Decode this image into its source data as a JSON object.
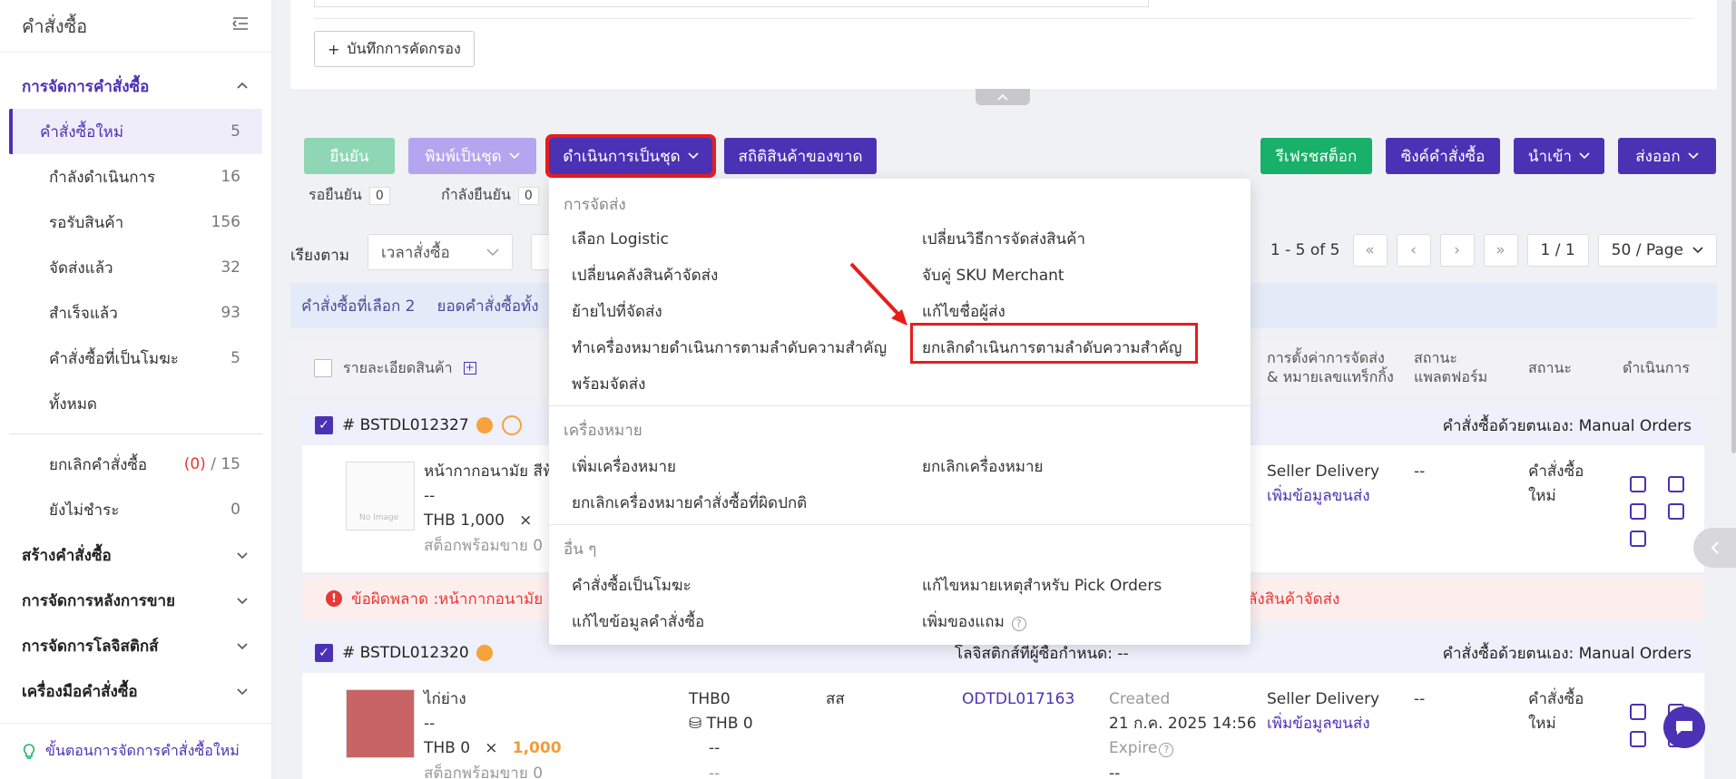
{
  "sidebar": {
    "title": "คำสั่งซื้อ",
    "group_manage": "การจัดการคำสั่งซื้อ",
    "items": [
      {
        "label": "คำสั่งซื้อใหม่",
        "count": "5"
      },
      {
        "label": "กำลังดำเนินการ",
        "count": "16"
      },
      {
        "label": "รอรับสินค้า",
        "count": "156"
      },
      {
        "label": "จัดส่งแล้ว",
        "count": "32"
      },
      {
        "label": "สำเร็จแล้ว",
        "count": "93"
      },
      {
        "label": "คำสั่งซื้อที่เป็นโมฆะ",
        "count": "5"
      },
      {
        "label": "ทั้งหมด",
        "count": ""
      }
    ],
    "cancel_label": "ยกเลิกคำสั่งซื้อ",
    "cancel_count_red": "(0)",
    "cancel_count_total": "/ 15",
    "unpaid_label": "ยังไม่ชำระ",
    "unpaid_count": "0",
    "group_create": "สร้างคำสั่งซื้อ",
    "group_after": "การจัดการหลังการขาย",
    "group_logistics": "การจัดการโลจิสติกส์",
    "group_tools": "เครื่องมือคำสั่งซื้อ",
    "footer": "ขั้นตอนการจัดการคำสั่งซื้อใหม่"
  },
  "filter": {
    "save_label": "บันทึกการคัดกรอง"
  },
  "toolbar": {
    "confirm": "ยืนยัน",
    "print_batch": "พิมพ์เป็นชุด",
    "batch_ops": "ดำเนินการเป็นชุด",
    "stats_oos": "สถิติสินค้าของขาด",
    "refresh_stock": "รีเฟรชสต็อก",
    "sync_orders": "ซิงค์คำสั่งซื้อ",
    "import": "นำเข้า",
    "export": "ส่งออก"
  },
  "status": {
    "pending_label": "รอยืนยัน",
    "pending_count": "0",
    "confirming_label": "กำลังยืนยัน",
    "confirming_count": "0"
  },
  "sort": {
    "label": "เรียงตาม",
    "value": "เวลาสั่งซื้อ"
  },
  "pager": {
    "range": "1 - 5 of 5",
    "page": "1 / 1",
    "per_page": "50 / Page"
  },
  "selection": {
    "selected": "คำสั่งซื้อที่เลือก 2",
    "total": "ยอดคำสั่งซื้อทั้ง"
  },
  "table_head": {
    "product": "รายละเอียดสินค้า",
    "shipping_setup_1": "การตั้งค่าการจัดส่ง",
    "shipping_setup_2": "& หมายเลขแทร็กกิ้ง",
    "platform_status_1": "สถานะ",
    "platform_status_2": "แพลตฟอร์ม",
    "status": "สถานะ",
    "action": "ดำเนินการ"
  },
  "orders": [
    {
      "id": "# BSTDL012327",
      "right": "คำสั่งซื้อด้วยตนเอง: Manual Orders",
      "product": "หน้ากากอนามัย สีฟ้",
      "dash": "--",
      "price": "THB 1,000",
      "times": "×",
      "stock": "สต็อกพร้อมขาย 0",
      "shipping": "Seller Delivery",
      "add_info": "เพิ่มข้อมูลขนส่ง",
      "platform": "--",
      "status_1": "คำสั่งซื้อ",
      "status_2": "ใหม่",
      "no_image": "No Image"
    },
    {
      "id": "# BSTDL012320",
      "middle": "โลจิสติกส์ที่ผู้ซื้อกำหนด: --",
      "right": "คำสั่งซื้อด้วยตนเอง: Manual Orders",
      "product": "ไก่ย่าง",
      "dash": "--",
      "price": "THB 0",
      "times": "×",
      "qty": "1,000",
      "stock": "สต็อกพร้อมขาย 0",
      "amount": "THB0",
      "amount2": "THB 0",
      "amount_dash": "--",
      "amount_dash2": "--",
      "payment": "สส",
      "ref": "ODTDL017163",
      "created_label": "Created",
      "created": "21 ก.ค. 2025 14:56",
      "expire": "Expire",
      "expire_dash": "--",
      "shipping": "Seller Delivery",
      "add_info": "เพิ่มข้อมูลขนส่ง",
      "platform": "--",
      "status_1": "คำสั่งซื้อ",
      "status_2": "ใหม่"
    }
  ],
  "error": {
    "text": "ข้อผิดพลาด :หน้ากากอนามัย สี",
    "tail": "ลังสินค้าจัดส่ง"
  },
  "dropdown": {
    "sec_shipping": "การจัดส่ง",
    "select_logistic": "เลือก Logistic",
    "change_ship_method": "เปลี่ยนวิธีการจัดส่งสินค้า",
    "change_warehouse": "เปลี่ยนคลังสินค้าจัดส่ง",
    "match_sku": "จับคู่ SKU Merchant",
    "move_to_ship": "ย้ายไปที่จัดส่ง",
    "edit_sender": "แก้ไขชื่อผู้ส่ง",
    "mark_priority": "ทำเครื่องหมายดำเนินการตามลำดับความสำคัญ",
    "cancel_priority": "ยกเลิกดำเนินการตามลำดับความสำคัญ",
    "ready_ship": "พร้อมจัดส่ง",
    "sec_mark": "เครื่องหมาย",
    "add_mark": "เพิ่มเครื่องหมาย",
    "cancel_mark": "ยกเลิกเครื่องหมาย",
    "cancel_abnormal": "ยกเลิกเครื่องหมายคำสั่งซื้อที่ผิดปกติ",
    "sec_other": "อื่น ๆ",
    "void_order": "คำสั่งซื้อเป็นโมฆะ",
    "edit_pick_note": "แก้ไขหมายเหตุสำหรับ Pick Orders",
    "edit_order_info": "แก้ไขข้อมูลคำสั่งซื้อ",
    "add_gift": "เพิ่มของแถม",
    "help": "?"
  },
  "colors": {
    "primary": "#4b32b5",
    "green": "#19b069",
    "highlight": "#e91c1c",
    "error": "#e53935"
  }
}
